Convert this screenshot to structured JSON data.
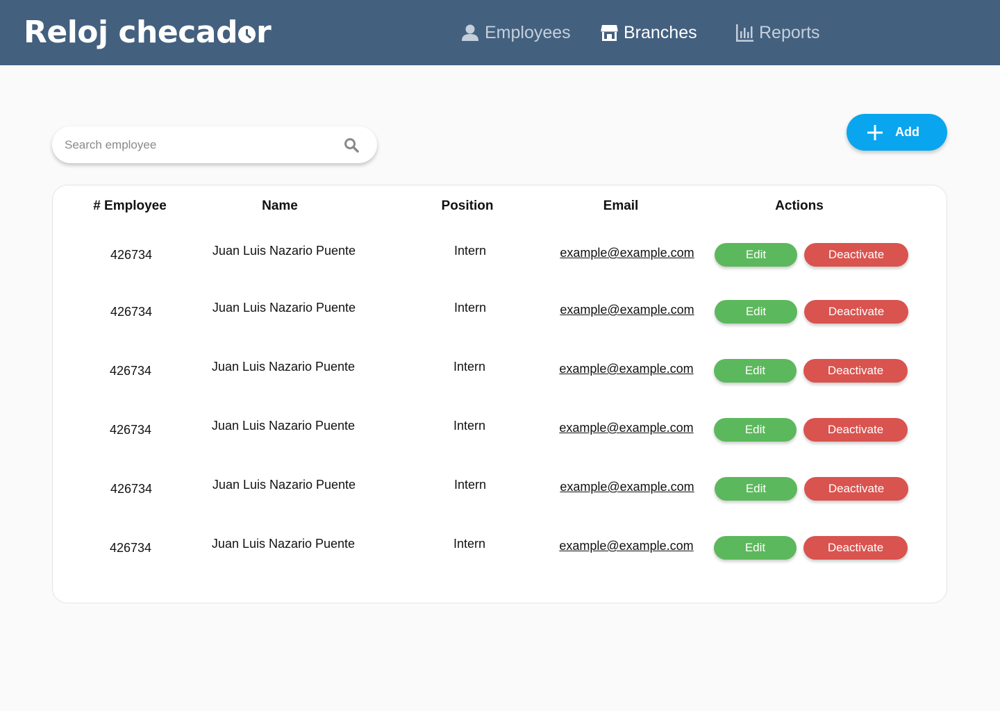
{
  "app": {
    "logo_text": "Reloj checad",
    "logo_text_end": "r"
  },
  "nav": [
    {
      "label": "Employees",
      "icon": "user-icon",
      "state": "inactive"
    },
    {
      "label": "Branches",
      "icon": "store-icon",
      "state": "active"
    },
    {
      "label": "Reports",
      "icon": "bar-chart-icon",
      "state": "inactive"
    }
  ],
  "search": {
    "placeholder": "Search employee",
    "value": ""
  },
  "add_button": {
    "label": "Add"
  },
  "table": {
    "columns": [
      "# Employee",
      "Name",
      "Position",
      "Email",
      "Actions"
    ],
    "rows": [
      {
        "id": "426734",
        "name": "Juan Luis Nazario Puente",
        "position": "Intern",
        "email": "example@example.com",
        "edit": "Edit",
        "deactivate": "Deactivate"
      },
      {
        "id": "426734",
        "name": "Juan Luis Nazario Puente",
        "position": "Intern",
        "email": "example@example.com",
        "edit": "Edit",
        "deactivate": "Deactivate"
      },
      {
        "id": "426734",
        "name": "Juan Luis Nazario Puente",
        "position": "Intern",
        "email": "example@example.com",
        "edit": "Edit",
        "deactivate": "Deactivate"
      },
      {
        "id": "426734",
        "name": "Juan Luis Nazario Puente",
        "position": "Intern",
        "email": "example@example.com",
        "edit": "Edit",
        "deactivate": "Deactivate"
      },
      {
        "id": "426734",
        "name": "Juan Luis Nazario Puente",
        "position": "Intern",
        "email": "example@example.com",
        "edit": "Edit",
        "deactivate": "Deactivate"
      },
      {
        "id": "426734",
        "name": "Juan Luis Nazario Puente",
        "position": "Intern",
        "email": "example@example.com",
        "edit": "Edit",
        "deactivate": "Deactivate"
      }
    ]
  },
  "colors": {
    "header": "#43607f",
    "add": "#0aa5ef",
    "edit": "#5cb85c",
    "deactivate": "#d9534f",
    "background": "#fafafa"
  }
}
